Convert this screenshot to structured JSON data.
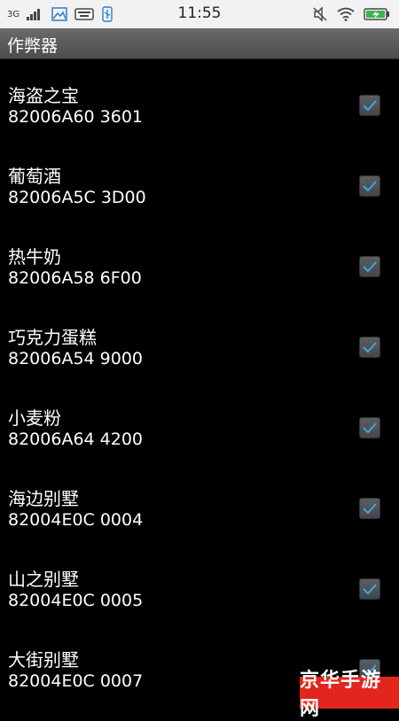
{
  "status_bar": {
    "network": "3G",
    "time": "11:55",
    "icons": [
      "signal-icon",
      "gallery-icon",
      "keyboard-icon",
      "usb-icon",
      "mute-icon",
      "wifi-icon",
      "battery-charging-icon"
    ]
  },
  "title": "作弊器",
  "items": [
    {
      "name": "海盗之宝",
      "code": "82006A60 3601",
      "checked": true
    },
    {
      "name": "葡萄酒",
      "code": "82006A5C 3D00",
      "checked": true
    },
    {
      "name": "热牛奶",
      "code": "82006A58 6F00",
      "checked": true
    },
    {
      "name": "巧克力蛋糕",
      "code": "82006A54 9000",
      "checked": true
    },
    {
      "name": "小麦粉",
      "code": "82006A64 4200",
      "checked": true
    },
    {
      "name": "海边别墅",
      "code": "82004E0C 0004",
      "checked": true
    },
    {
      "name": "山之别墅",
      "code": "82004E0C 0005",
      "checked": true
    },
    {
      "name": "大街别墅",
      "code": "82004E0C 0007",
      "checked": true
    }
  ],
  "watermark": "京华手游网",
  "colors": {
    "checkbox_check": "#3aa8e0",
    "watermark_bg": "#e2261d"
  }
}
